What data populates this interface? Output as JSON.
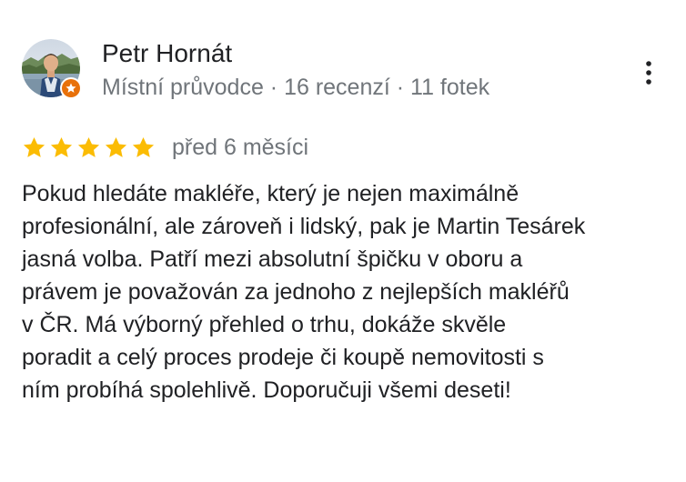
{
  "reviewer": {
    "name": "Petr Hornát",
    "meta": "Místní průvodce · 16 recenzí · 11 fotek"
  },
  "icons": {
    "avatar": "reviewer-profile-photo",
    "badge": "local-guide-star-badge",
    "more": "more-vert-icon",
    "star": "star-icon"
  },
  "colors": {
    "star": "#fbbc04",
    "badge": "#e8710a",
    "secondary_text": "#70757a",
    "primary_text": "#202124"
  },
  "review": {
    "rating": 5,
    "max_rating": 5,
    "date": "před 6 měsíci",
    "text_lines": [
      "Pokud hledáte makléře, který je nejen maximálně",
      "profesionální, ale zároveň i lidský, pak je Martin Tesárek",
      "jasná volba. Patří mezi absolutní špičku v oboru a",
      "právem je považován za jednoho z nejlepších makléřů",
      "v ČR. Má výborný přehled o trhu, dokáže skvěle",
      "poradit a celý proces prodeje či koupě nemovitosti s",
      "ním probíhá spolehlivě. Doporučuji všemi deseti!"
    ]
  }
}
